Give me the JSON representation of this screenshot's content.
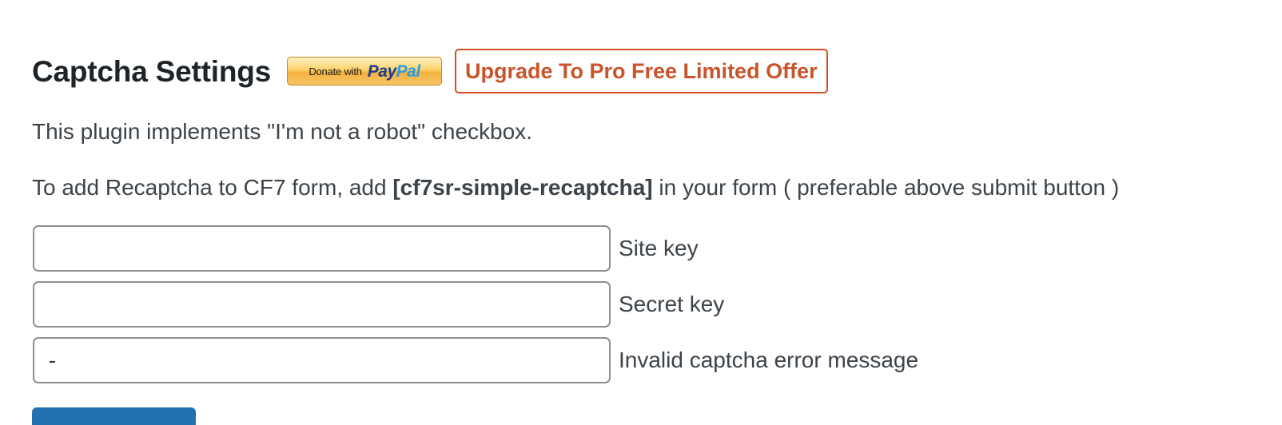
{
  "header": {
    "title": "Captcha Settings",
    "donate_button": {
      "donate_label": "Donate with",
      "logo_pay": "Pay",
      "logo_pal": "Pal"
    },
    "upgrade_label": "Upgrade To Pro Free Limited Offer"
  },
  "intro_text": "This plugin implements \"I'm not a robot\" checkbox.",
  "instructions": {
    "before": "To add Recaptcha to CF7 form, add ",
    "shortcode": "[cf7sr-simple-recaptcha]",
    "after": " in your form ( preferable above submit button )"
  },
  "fields": {
    "site_key": {
      "label": "Site key",
      "value": ""
    },
    "secret_key": {
      "label": "Secret key",
      "value": ""
    },
    "error_message": {
      "label": "Invalid captcha error message",
      "value": "-"
    }
  },
  "colors": {
    "title": "#1d2327",
    "text": "#3c434a",
    "upgrade_accent": "#c8542b",
    "primary_button": "#2271b1",
    "paypal_pay": "#1b3d8f",
    "paypal_pal": "#2d9ce0"
  }
}
